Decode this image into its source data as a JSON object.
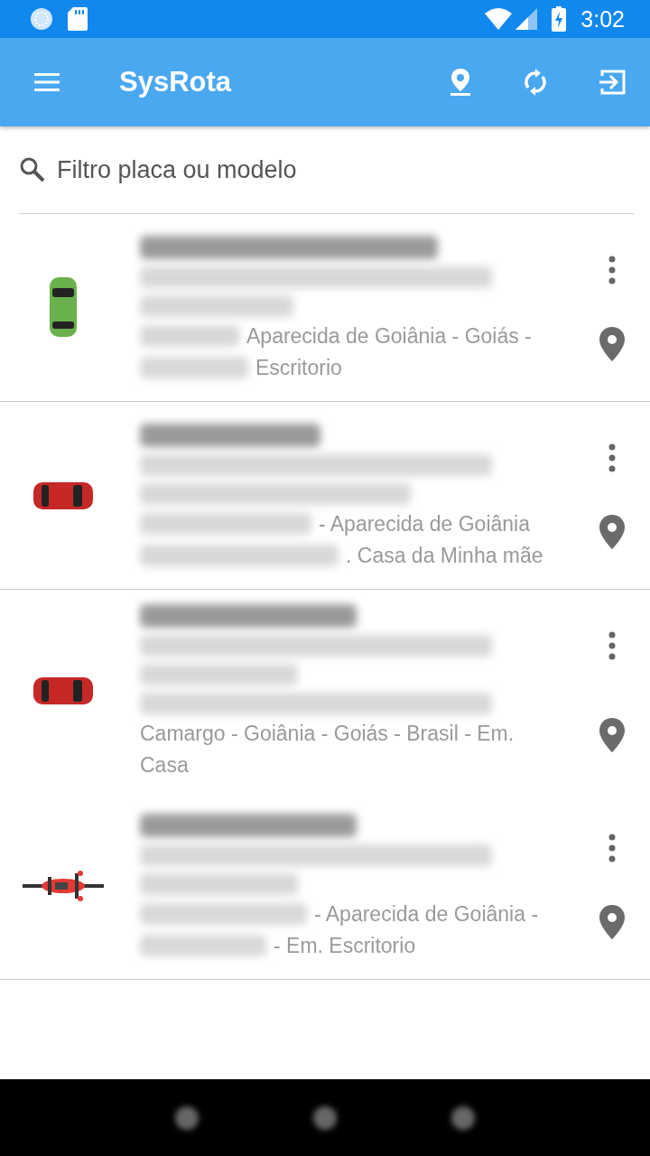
{
  "status_bar": {
    "time": "3:02"
  },
  "app_bar": {
    "title": "SysRota"
  },
  "search": {
    "placeholder": "Filtro placa ou modelo"
  },
  "vehicles": [
    {
      "kind": "car",
      "color": "#6ab04c",
      "divider": true,
      "address_lines": [
        "Aparecida de Goiânia - Goiás -",
        "Escritorio"
      ]
    },
    {
      "kind": "car",
      "color": "#c62828",
      "divider": true,
      "address_lines": [
        "- Aparecida de Goiânia",
        ". Casa da Minha mãe"
      ]
    },
    {
      "kind": "car",
      "color": "#c62828",
      "divider": false,
      "address_lines": [
        "Camargo - Goiânia - Goiás - Brasil - Em.",
        "Casa"
      ]
    },
    {
      "kind": "motorcycle",
      "color": "#e53935",
      "divider": true,
      "address_lines": [
        "- Aparecida de Goiânia -",
        "- Em. Escritorio"
      ]
    }
  ]
}
